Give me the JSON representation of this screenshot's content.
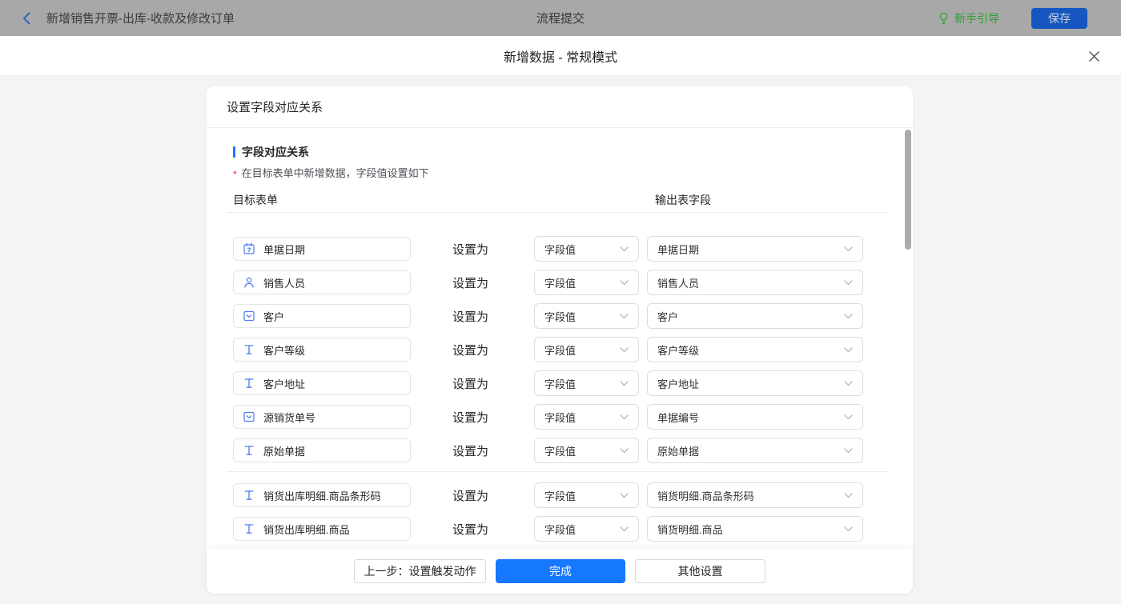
{
  "topbar": {
    "title": "新增销售开票-出库-收款及修改订单",
    "center_title": "流程提交",
    "guide_label": "新手引导",
    "save_label": "保存"
  },
  "modal": {
    "title": "新增数据 - 常规模式"
  },
  "panel": {
    "header": "设置字段对应关系",
    "section_title": "字段对应关系",
    "required_mark": "*",
    "note": "在目标表单中新增数据，字段值设置如下",
    "col_target": "目标表单",
    "col_output": "输出表字段",
    "set_as": "设置为",
    "rows": [
      {
        "icon": "calendar",
        "field": "单据日期",
        "mode": "字段值",
        "value": "单据日期",
        "group": 1
      },
      {
        "icon": "user",
        "field": "销售人员",
        "mode": "字段值",
        "value": "销售人员",
        "group": 1
      },
      {
        "icon": "select",
        "field": "客户",
        "mode": "字段值",
        "value": "客户",
        "group": 1
      },
      {
        "icon": "text",
        "field": "客户等级",
        "mode": "字段值",
        "value": "客户等级",
        "group": 1
      },
      {
        "icon": "text",
        "field": "客户地址",
        "mode": "字段值",
        "value": "客户地址",
        "group": 1
      },
      {
        "icon": "select",
        "field": "源销货单号",
        "mode": "字段值",
        "value": "单据编号",
        "group": 1
      },
      {
        "icon": "text",
        "field": "原始单据",
        "mode": "字段值",
        "value": "原始单据",
        "group": 1
      },
      {
        "icon": "text",
        "field": "销货出库明细.商品条形码",
        "mode": "字段值",
        "value": "销货明细.商品条形码",
        "group": 2
      },
      {
        "icon": "text",
        "field": "销货出库明细.商品",
        "mode": "字段值",
        "value": "销货明细.商品",
        "group": 2
      }
    ]
  },
  "footer": {
    "prev_label": "上一步：设置触发动作",
    "done_label": "完成",
    "other_label": "其他设置"
  },
  "colors": {
    "primary_blue": "#1677ff",
    "field_icon_blue": "#4a7cf0",
    "guide_green": "#2ba135",
    "save_button_blue": "#1656c0",
    "topbar_dimmed_bg": "#a8a8a8",
    "background_gray": "#f4f4f6"
  }
}
